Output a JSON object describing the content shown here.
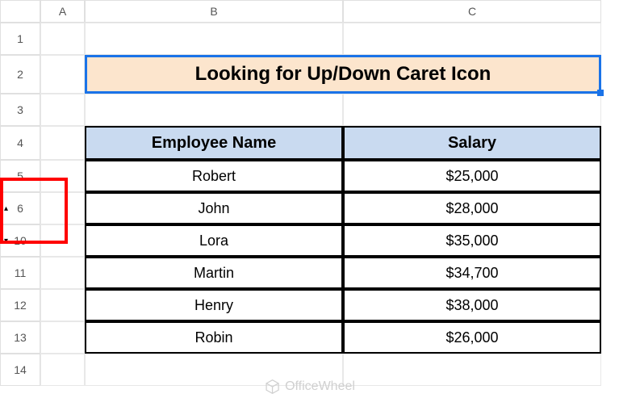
{
  "columns": [
    "A",
    "B",
    "C"
  ],
  "rows": [
    "1",
    "2",
    "3",
    "4",
    "5",
    "6",
    "10",
    "11",
    "12",
    "13",
    "14"
  ],
  "title": "Looking for Up/Down Caret Icon",
  "table": {
    "headers": [
      "Employee Name",
      "Salary"
    ],
    "data": [
      [
        "Robert",
        "$25,000"
      ],
      [
        "John",
        "$28,000"
      ],
      [
        "Lora",
        "$35,000"
      ],
      [
        "Martin",
        "$34,700"
      ],
      [
        "Henry",
        "$38,000"
      ],
      [
        "Robin",
        "$26,000"
      ]
    ]
  },
  "watermark": "OfficeWheel",
  "chart_data": {
    "type": "table",
    "title": "Looking for Up/Down Caret Icon",
    "columns": [
      "Employee Name",
      "Salary"
    ],
    "rows": [
      {
        "Employee Name": "Robert",
        "Salary": 25000
      },
      {
        "Employee Name": "John",
        "Salary": 28000
      },
      {
        "Employee Name": "Lora",
        "Salary": 35000
      },
      {
        "Employee Name": "Martin",
        "Salary": 34700
      },
      {
        "Employee Name": "Henry",
        "Salary": 38000
      },
      {
        "Employee Name": "Robin",
        "Salary": 26000
      }
    ]
  }
}
